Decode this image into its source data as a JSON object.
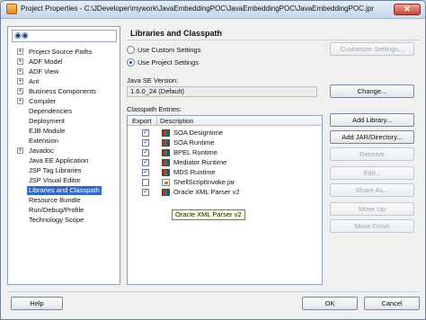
{
  "window": {
    "title": "Project Properties - C:\\JDeveloper\\mywork\\JavaEmbeddingPOC\\JavaEmbeddingPOC\\JavaEmbeddingPOC.jpr",
    "close_glyph": "✕"
  },
  "tree": {
    "search_value": "",
    "items": [
      {
        "label": "Project Source Paths",
        "expander": "+"
      },
      {
        "label": "ADF Model",
        "expander": "+"
      },
      {
        "label": "ADF View",
        "expander": "+"
      },
      {
        "label": "Ant",
        "expander": "+"
      },
      {
        "label": "Business Components",
        "expander": "+"
      },
      {
        "label": "Compiler",
        "expander": "+"
      },
      {
        "label": "Dependencies",
        "expander": ""
      },
      {
        "label": "Deployment",
        "expander": ""
      },
      {
        "label": "EJB Module",
        "expander": ""
      },
      {
        "label": "Extension",
        "expander": ""
      },
      {
        "label": "Javadoc",
        "expander": "+"
      },
      {
        "label": "Java EE Application",
        "expander": ""
      },
      {
        "label": "JSP Tag Libraries",
        "expander": ""
      },
      {
        "label": "JSP Visual Editor",
        "expander": ""
      },
      {
        "label": "Libraries and Classpath",
        "expander": "",
        "selected": true
      },
      {
        "label": "Resource Bundle",
        "expander": ""
      },
      {
        "label": "Run/Debug/Profile",
        "expander": ""
      },
      {
        "label": "Technology Scope",
        "expander": ""
      }
    ]
  },
  "main": {
    "title": "Libraries and Classpath",
    "radio_custom": "Use Custom Settings",
    "radio_project": "Use Project Settings",
    "customize_button": "Customize Settings...",
    "jdk_label": "Java SE Version:",
    "jdk_value": "1.6.0_24 (Default)",
    "change_button": "Change...",
    "classpath_label": "Classpath Entries:",
    "col_export": "Export",
    "col_description": "Description",
    "rows": [
      {
        "label": "SOA Designtime",
        "checked": true,
        "icon": "library-icon"
      },
      {
        "label": "SOA Runtime",
        "checked": true,
        "icon": "library-icon"
      },
      {
        "label": "BPEL Runtime",
        "checked": true,
        "icon": "library-icon"
      },
      {
        "label": "Mediator Runtime",
        "checked": true,
        "icon": "library-icon"
      },
      {
        "label": "MDS Runtime",
        "checked": true,
        "icon": "library-icon"
      },
      {
        "label": "ShellScriptInvoke.jar",
        "checked": false,
        "icon": "jar-icon"
      },
      {
        "label": "Oracle XML Parser v2",
        "checked": true,
        "icon": "library-icon"
      }
    ],
    "tooltip": "Oracle XML Parser v2",
    "buttons": {
      "add_library": "Add Library...",
      "add_jar": "Add JAR/Directory...",
      "remove": "Remove",
      "edit": "Edit...",
      "share_as": "Share As...",
      "move_up": "Move Up",
      "move_down": "Move Down"
    }
  },
  "footer": {
    "help": "Help",
    "ok": "OK",
    "cancel": "Cancel"
  }
}
